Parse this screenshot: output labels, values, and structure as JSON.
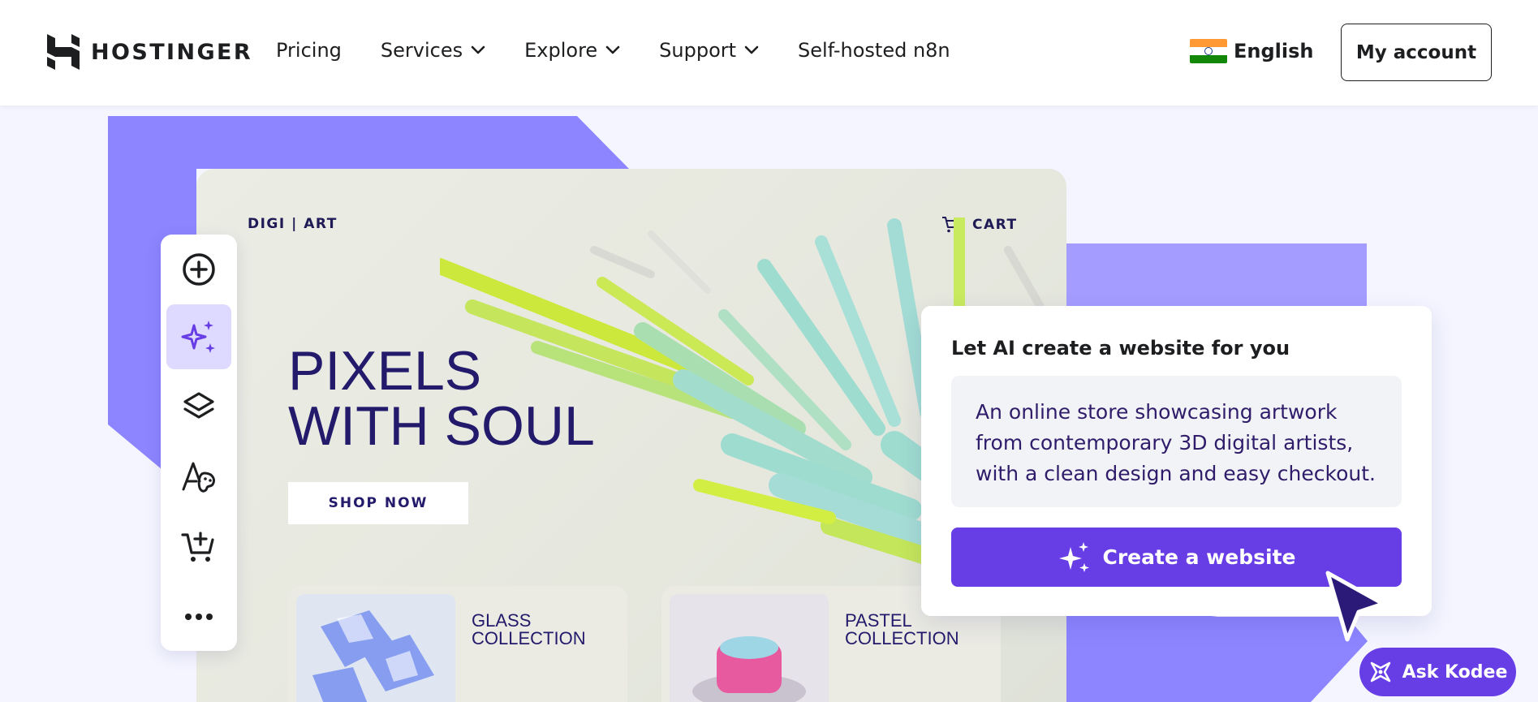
{
  "header": {
    "brand": "HOSTINGER",
    "nav": [
      {
        "label": "Pricing",
        "dropdown": false
      },
      {
        "label": "Services",
        "dropdown": true
      },
      {
        "label": "Explore",
        "dropdown": true
      },
      {
        "label": "Support",
        "dropdown": true
      },
      {
        "label": "Self-hosted n8n",
        "dropdown": false
      }
    ],
    "language": "English",
    "language_flag_icon": "india-flag-icon",
    "account_label": "My account"
  },
  "mockup": {
    "brand": "DIGI | ART",
    "cart_label": "CART",
    "hero_line1": "PIXELS",
    "hero_line2": "WITH SOUL",
    "shop_button": "SHOP NOW",
    "cards": [
      {
        "line1": "GLASS",
        "line2": "COLLECTION"
      },
      {
        "line1": "PASTEL",
        "line2": "COLLECTION"
      }
    ]
  },
  "toolbar": {
    "tools": [
      "add-icon",
      "ai-sparkle-icon",
      "layers-icon",
      "typography-palette-icon",
      "add-to-cart-icon",
      "more-icon"
    ],
    "active_tool": "ai-sparkle-icon"
  },
  "ai_panel": {
    "title": "Let AI create a website for you",
    "prompt": "An online store showcasing artwork from contemporary 3D digital artists, with a clean design and easy checkout.",
    "button_label": "Create a website"
  },
  "assistant": {
    "label": "Ask Kodee"
  },
  "colors": {
    "accent": "#673de6",
    "shape_dark": "#8c85ff",
    "shape_light": "#a49dff",
    "hero_text": "#231a6b"
  }
}
